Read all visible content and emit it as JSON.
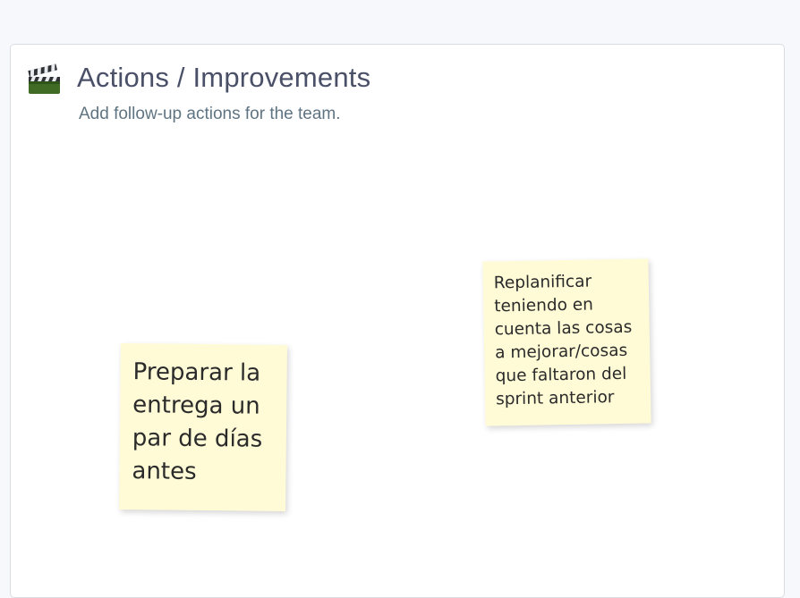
{
  "section": {
    "icon": "clapperboard-icon",
    "title": "Actions / Improvements",
    "subtitle": "Add follow-up actions for the team."
  },
  "notes": [
    {
      "text": "Preparar la\nentrega un\npar de días\nantes",
      "color": "#fffbd6"
    },
    {
      "text": "Replanificar\nteniendo en\ncuenta las cosas\na mejorar/cosas\nque faltaron del\nsprint anterior",
      "color": "#fffbd6"
    }
  ],
  "colors": {
    "page_background": "#f6f8fb",
    "panel_background": "#ffffff",
    "title": "#4a5068",
    "subtitle": "#5f7482",
    "sticky": "#fffbd6"
  }
}
